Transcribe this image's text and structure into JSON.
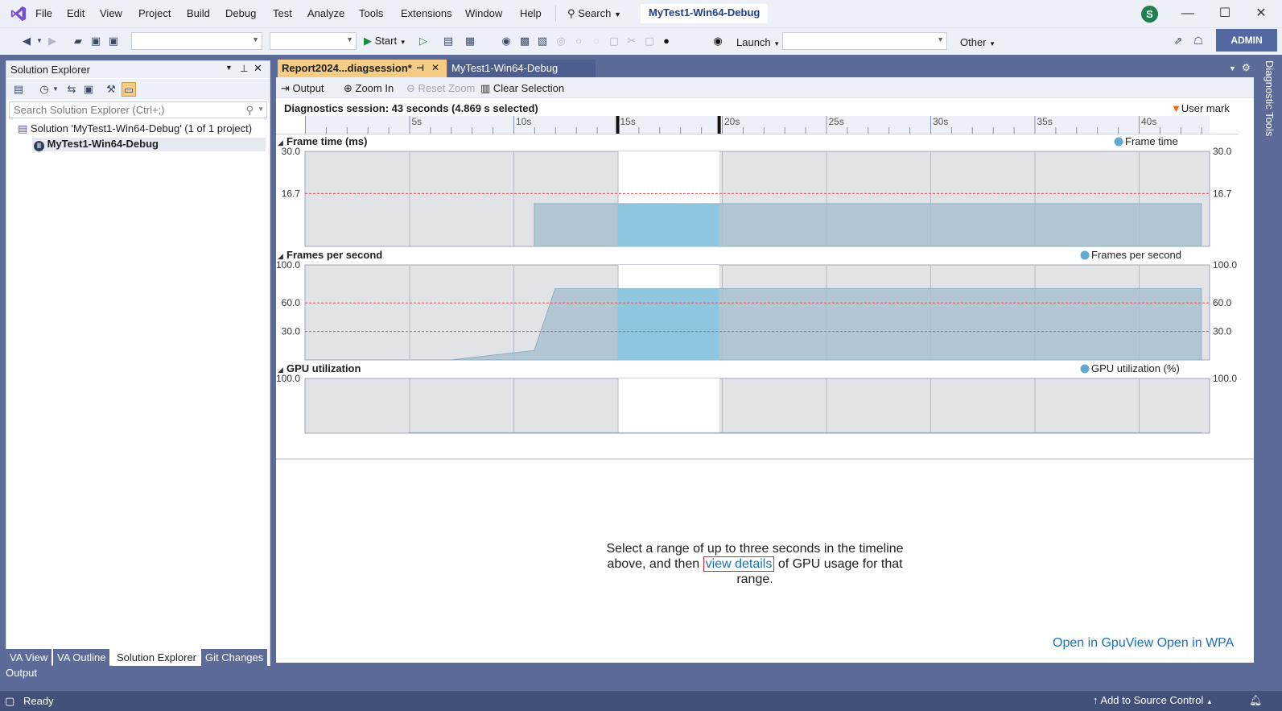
{
  "menu": {
    "items": [
      "File",
      "Edit",
      "View",
      "Project",
      "Build",
      "Debug",
      "Test",
      "Analyze",
      "Tools",
      "Extensions",
      "Window",
      "Help"
    ],
    "search": "Search",
    "title": "MyTest1-Win64-Debug",
    "avatar": "S"
  },
  "toolbar": {
    "start": "Start",
    "launch": "Launch",
    "other": "Other",
    "admin": "ADMIN"
  },
  "solution_explorer": {
    "title": "Solution Explorer",
    "search_placeholder": "Search Solution Explorer (Ctrl+;)",
    "solution": "Solution 'MyTest1-Win64-Debug' (1 of 1 project)",
    "project": "MyTest1-Win64-Debug",
    "bottom_tabs": [
      "VA View",
      "VA Outline",
      "Solution Explorer",
      "Git Changes"
    ]
  },
  "output_label": "Output",
  "status": {
    "ready": "Ready",
    "source_control": "Add to Source Control"
  },
  "doc_tabs": [
    "Report2024...diagsession*",
    "MyTest1-Win64-Debug"
  ],
  "doc_toolbar": {
    "output": "Output",
    "zoom_in": "Zoom In",
    "reset_zoom": "Reset Zoom",
    "clear_selection": "Clear Selection"
  },
  "session": "Diagnostics session: 43 seconds (4.869 s selected)",
  "user_mark": "User mark",
  "side_label": "Diagnostic Tools",
  "ruler_ticks": [
    "5s",
    "10s",
    "15s",
    "20s",
    "25s",
    "30s",
    "35s",
    "40s"
  ],
  "chart_data": [
    {
      "type": "area",
      "title": "Frame time (ms)",
      "legend": "Frame time",
      "ylim": [
        0,
        30
      ],
      "ref_lines": [
        16.7
      ],
      "ticks": [
        "30.0",
        "16.7"
      ],
      "x": [
        11,
        43
      ],
      "y": [
        13.5,
        13.5
      ],
      "selection": [
        15,
        19.87
      ]
    },
    {
      "type": "area",
      "title": "Frames per second",
      "legend": "Frames per second",
      "ylim": [
        0,
        100
      ],
      "ref_lines": [
        60,
        30
      ],
      "ticks": [
        "100.0",
        "60.0",
        "30.0"
      ],
      "x": [
        7,
        11,
        12,
        43
      ],
      "y": [
        0,
        10,
        75,
        75
      ],
      "selection": [
        15,
        19.87
      ]
    },
    {
      "type": "area",
      "title": "GPU utilization",
      "legend": "GPU utilization (%)",
      "ylim": [
        0,
        100
      ],
      "ticks": [
        "100.0"
      ],
      "x": [
        5,
        43
      ],
      "y": [
        1,
        1
      ],
      "selection": [
        15,
        19.87
      ]
    }
  ],
  "message": {
    "before": "Select a range of up to three seconds in the timeline above, and then",
    "link": "view details",
    "after": "of GPU usage for that range."
  },
  "links": {
    "gpuview": "Open in GpuView",
    "wpa": "Open in WPA"
  }
}
